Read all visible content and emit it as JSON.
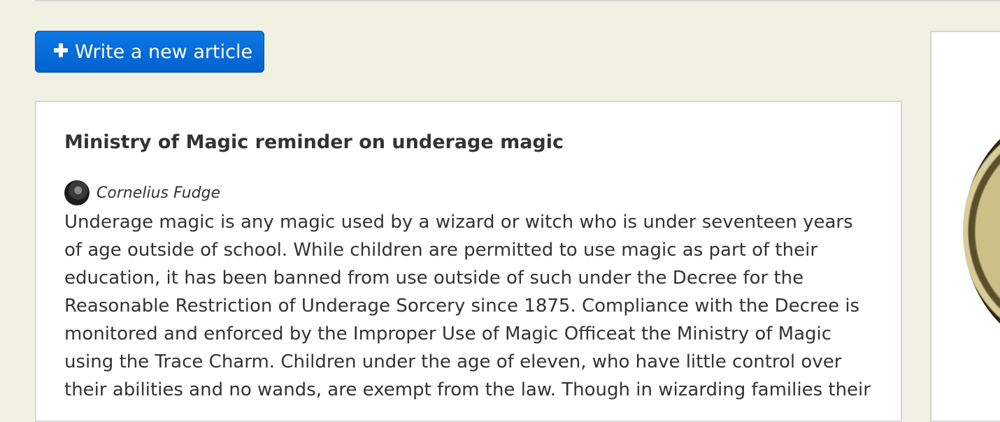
{
  "actions": {
    "write_button_label": "Write a new article"
  },
  "article": {
    "title": "Ministry of Magic reminder on underage magic",
    "author": "Cornelius Fudge",
    "body": "Underage magic is any magic used by a wizard or witch who is under seventeen years of age outside of school. While children are permitted to use magic as part of their education, it has been banned from use outside of such under the Decree for the Reasonable Restriction of Underage Sorcery since 1875. Compliance with the Decree is monitored and enforced by the Improper Use of Magic Officeat the Ministry of Magic using the Trace Charm. Children under the age of eleven, who have little control over their abilities and no wands, are exempt from the law. Though in wizarding families their"
  }
}
